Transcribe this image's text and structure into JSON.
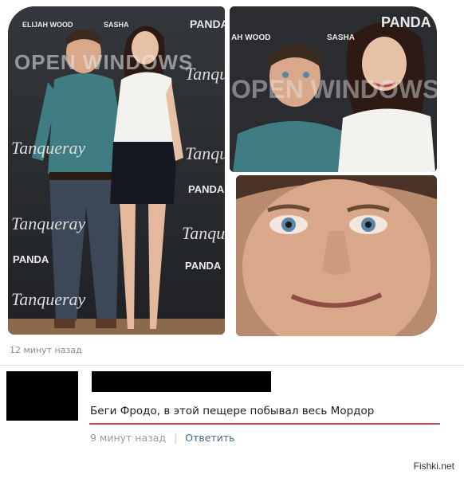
{
  "photos": {
    "left_panel": {
      "names": [
        "ELIJAH WOOD",
        "SASHA"
      ],
      "title": "OPEN WINDOWS",
      "brand": "PANDA",
      "script": "Tanqueray"
    },
    "top_right_panel": {
      "names": [
        "AH WOOD",
        "SASHA"
      ],
      "title": "OPEN WINDOWS",
      "brand": "PANDA"
    }
  },
  "post": {
    "time": "12 минут назад"
  },
  "comment": {
    "text": "Беги Фродо, в этой пещере побывал весь Мордор",
    "time": "9 минут назад",
    "reply_label": "Ответить"
  },
  "watermark": "Fishki.net",
  "colors": {
    "reply_link": "#45688e",
    "underline": "#c44a4a",
    "meta_text": "#9a9a9a"
  }
}
